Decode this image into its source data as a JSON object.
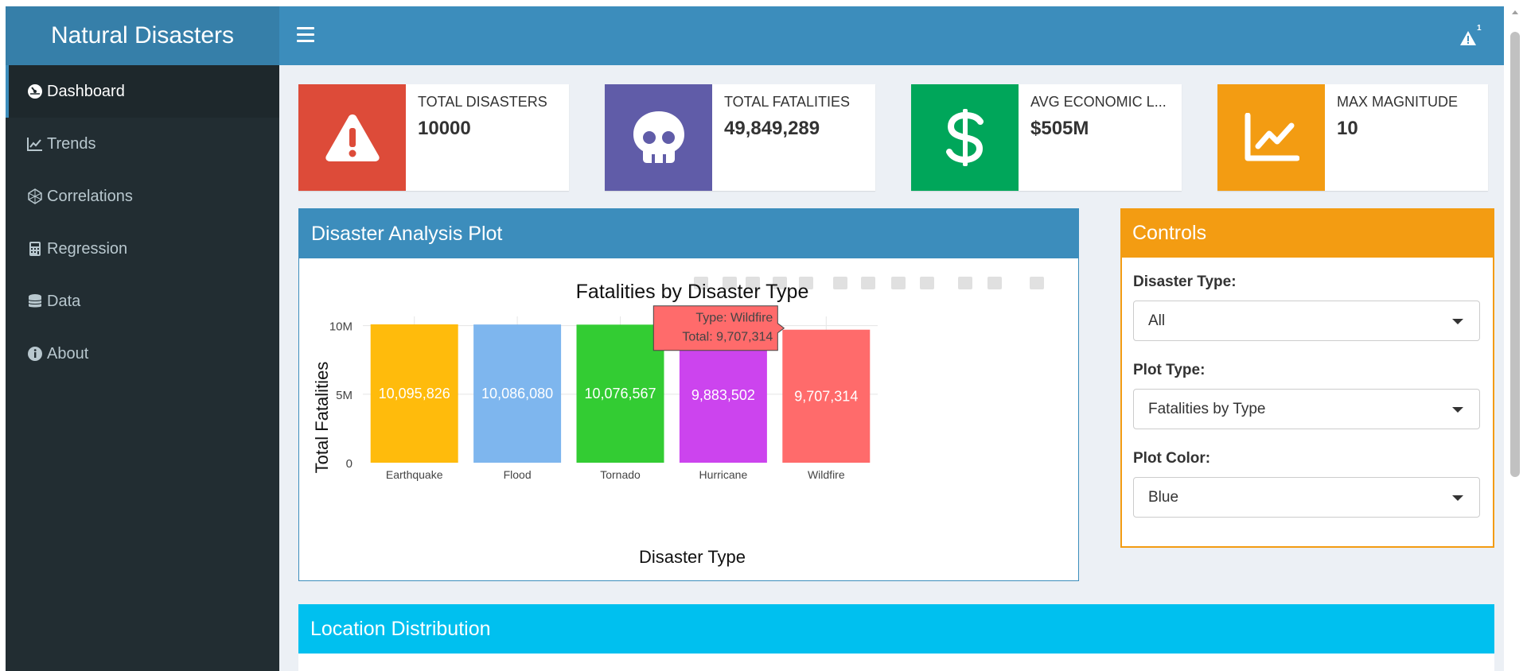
{
  "app": {
    "title": "Natural Disasters"
  },
  "notifications": {
    "count": "1"
  },
  "sidebar": {
    "items": [
      {
        "label": "Dashboard",
        "icon": "dashboard-icon",
        "active": true
      },
      {
        "label": "Trends",
        "icon": "line-chart-icon"
      },
      {
        "label": "Correlations",
        "icon": "network-icon"
      },
      {
        "label": "Regression",
        "icon": "calculator-icon"
      },
      {
        "label": "Data",
        "icon": "database-icon"
      },
      {
        "label": "About",
        "icon": "info-icon"
      }
    ]
  },
  "infoboxes": [
    {
      "label": "TOTAL DISASTERS",
      "value": "10000",
      "icon": "warning-icon",
      "color": "#dd4b39"
    },
    {
      "label": "TOTAL FATALITIES",
      "value": "49,849,289",
      "icon": "skull-icon",
      "color": "#605ca8"
    },
    {
      "label": "AVG ECONOMIC L...",
      "value": "$505M",
      "icon": "dollar-icon",
      "color": "#00a65a"
    },
    {
      "label": "MAX MAGNITUDE",
      "value": "10",
      "icon": "chart-line-icon",
      "color": "#f39c12"
    }
  ],
  "plot_box": {
    "title": "Disaster Analysis Plot"
  },
  "controls": {
    "title": "Controls",
    "disaster_type": {
      "label": "Disaster Type:",
      "value": "All"
    },
    "plot_type": {
      "label": "Plot Type:",
      "value": "Fatalities by Type"
    },
    "plot_color": {
      "label": "Plot Color:",
      "value": "Blue"
    }
  },
  "location_box": {
    "title": "Location Distribution"
  },
  "chart_data": {
    "type": "bar",
    "title": "Fatalities by Disaster Type",
    "xlabel": "Disaster Type",
    "ylabel": "Total Fatalities",
    "categories": [
      "Earthquake",
      "Flood",
      "Tornado",
      "Hurricane",
      "Wildfire"
    ],
    "values": [
      10095826,
      10086080,
      10076567,
      9883502,
      9707314
    ],
    "value_labels": [
      "10,095,826",
      "10,086,080",
      "10,076,567",
      "9,883,502",
      "9,707,314"
    ],
    "colors": [
      "#ffbb0c",
      "#7eb6ee",
      "#33cc33",
      "#cc44ee",
      "#ff6b6b"
    ],
    "yticks": [
      0,
      5000000,
      10000000
    ],
    "ytick_labels": [
      "0",
      "5M",
      "10M"
    ],
    "ylim": [
      0,
      10095826
    ],
    "grid": true,
    "tooltip": {
      "line1": "Type: Wildfire",
      "line2": "Total:  9,707,314",
      "category": "Wildfire"
    }
  }
}
